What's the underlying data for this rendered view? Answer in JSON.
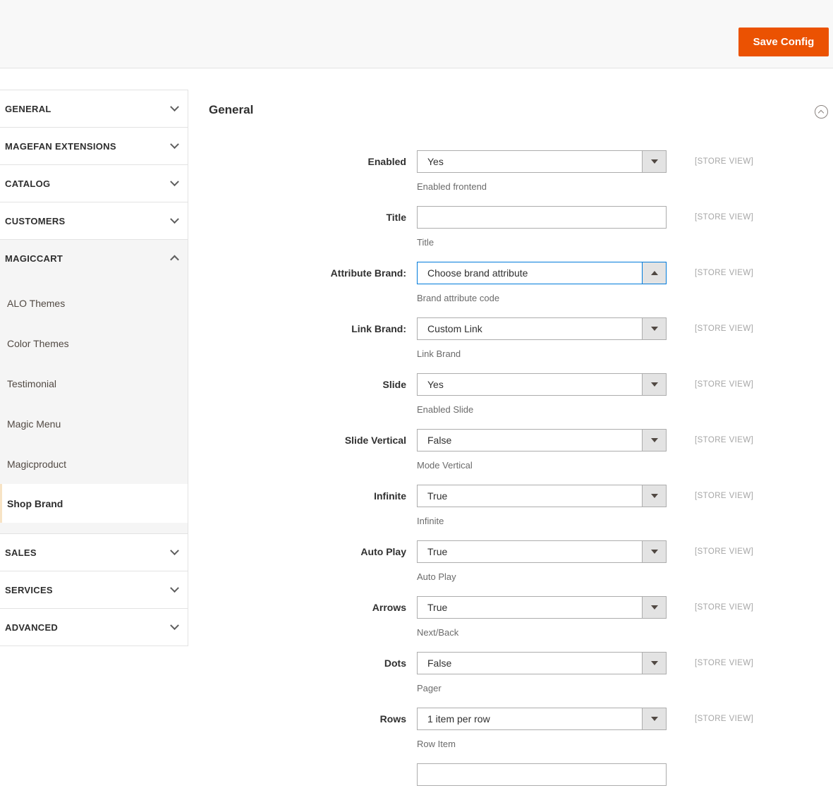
{
  "header": {
    "save_button": "Save Config"
  },
  "sidebar": {
    "sections": [
      {
        "key": "general",
        "label": "GENERAL",
        "state": "collapsed"
      },
      {
        "key": "magefan-extensions",
        "label": "MAGEFAN EXTENSIONS",
        "state": "collapsed"
      },
      {
        "key": "catalog",
        "label": "CATALOG",
        "state": "collapsed"
      },
      {
        "key": "customers",
        "label": "CUSTOMERS",
        "state": "collapsed"
      },
      {
        "key": "magiccart",
        "label": "MAGICCART",
        "state": "expanded",
        "items": [
          {
            "key": "alo-themes",
            "label": "ALO Themes",
            "active": false
          },
          {
            "key": "color-themes",
            "label": "Color Themes",
            "active": false
          },
          {
            "key": "testimonial",
            "label": "Testimonial",
            "active": false
          },
          {
            "key": "magic-menu",
            "label": "Magic Menu",
            "active": false
          },
          {
            "key": "magicproduct",
            "label": "Magicproduct",
            "active": false
          },
          {
            "key": "shop-brand",
            "label": "Shop Brand",
            "active": true
          }
        ]
      },
      {
        "key": "sales",
        "label": "SALES",
        "state": "collapsed"
      },
      {
        "key": "services",
        "label": "SERVICES",
        "state": "collapsed"
      },
      {
        "key": "advanced",
        "label": "ADVANCED",
        "state": "collapsed"
      }
    ]
  },
  "main": {
    "section_title": "General",
    "rows": [
      {
        "key": "enabled",
        "label": "Enabled",
        "type": "select",
        "value": "Yes",
        "note": "Enabled frontend",
        "scope": "[STORE VIEW]",
        "focused": false
      },
      {
        "key": "title",
        "label": "Title",
        "type": "text",
        "value": "",
        "note": "Title",
        "scope": "[STORE VIEW]",
        "focused": false
      },
      {
        "key": "attribute-brand",
        "label": "Attribute Brand:",
        "type": "select",
        "value": "Choose brand attribute",
        "note": "Brand attribute code",
        "scope": "[STORE VIEW]",
        "focused": true
      },
      {
        "key": "link-brand",
        "label": "Link Brand:",
        "type": "select",
        "value": "Custom Link",
        "note": "Link Brand",
        "scope": "[STORE VIEW]",
        "focused": false
      },
      {
        "key": "slide",
        "label": "Slide",
        "type": "select",
        "value": "Yes",
        "note": "Enabled Slide",
        "scope": "[STORE VIEW]",
        "focused": false
      },
      {
        "key": "slide-vertical",
        "label": "Slide Vertical",
        "type": "select",
        "value": "False",
        "note": "Mode Vertical",
        "scope": "[STORE VIEW]",
        "focused": false
      },
      {
        "key": "infinite",
        "label": "Infinite",
        "type": "select",
        "value": "True",
        "note": "Infinite",
        "scope": "[STORE VIEW]",
        "focused": false
      },
      {
        "key": "auto-play",
        "label": "Auto Play",
        "type": "select",
        "value": "True",
        "note": "Auto Play",
        "scope": "[STORE VIEW]",
        "focused": false
      },
      {
        "key": "arrows",
        "label": "Arrows",
        "type": "select",
        "value": "True",
        "note": "Next/Back",
        "scope": "[STORE VIEW]",
        "focused": false
      },
      {
        "key": "dots",
        "label": "Dots",
        "type": "select",
        "value": "False",
        "note": "Pager",
        "scope": "[STORE VIEW]",
        "focused": false
      },
      {
        "key": "rows",
        "label": "Rows",
        "type": "select",
        "value": "1 item per row",
        "note": "Row Item",
        "scope": "[STORE VIEW]",
        "focused": false
      },
      {
        "key": "partial-bottom",
        "label": "",
        "type": "partial",
        "value": "",
        "note": "",
        "scope": "",
        "focused": false
      }
    ]
  },
  "colors": {
    "accent": "#eb5202",
    "focus_border": "#007bdb"
  }
}
